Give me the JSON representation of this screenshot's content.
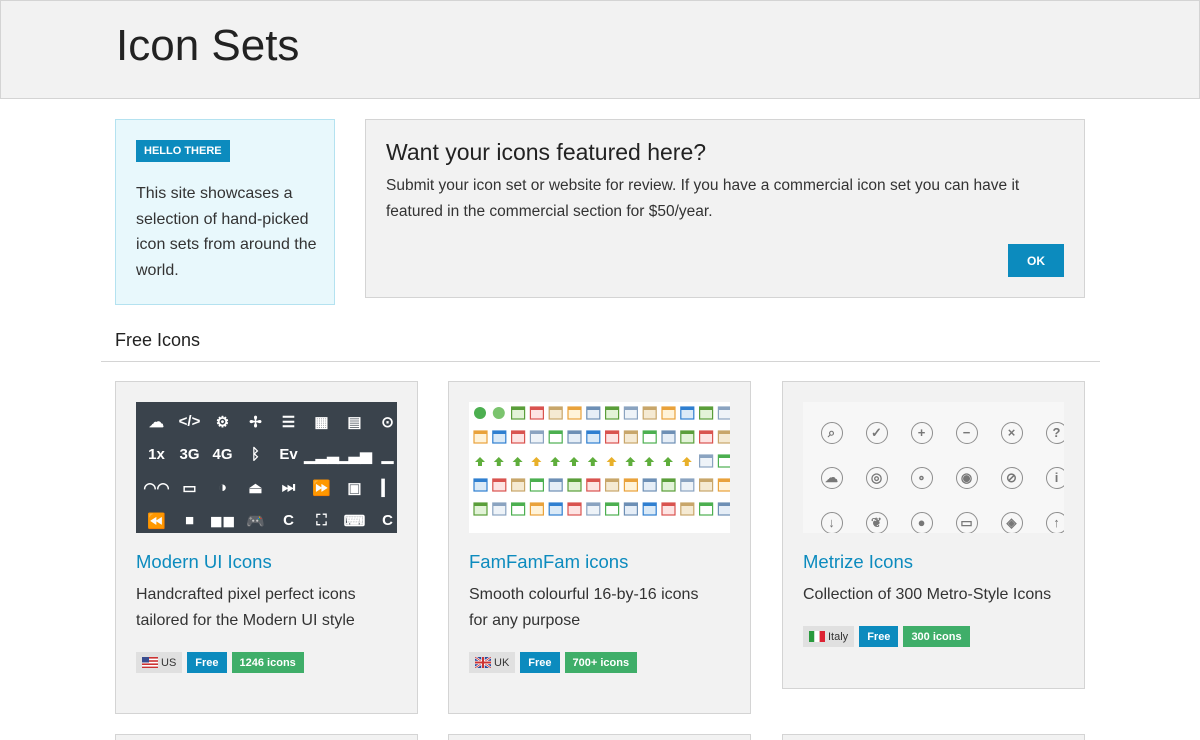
{
  "header": {
    "title": "Icon Sets"
  },
  "hello": {
    "badge": "HELLO THERE",
    "text": "This site showcases a selection of hand-picked icon sets from around the world."
  },
  "feature": {
    "title": "Want your icons featured here?",
    "text": "Submit your icon set or website for review. If you have a commercial icon set you can have it featured in the commercial section for $50/year.",
    "ok_label": "OK"
  },
  "section": {
    "title": "Free Icons"
  },
  "cards": [
    {
      "title": "Modern UI Icons",
      "description": "Handcrafted pixel perfect icons tailored for the Modern UI style",
      "country": "US",
      "license": "Free",
      "count": "1246 icons",
      "thumb_glyphs": [
        "☁",
        "</>",
        "⚙",
        "✢",
        "☰",
        "▦",
        "▤",
        "⊙",
        "1x",
        "3G",
        "4G",
        "ᛒ",
        "Ev",
        "▁▂▃",
        "▁▃▅",
        "▁",
        "◠◠",
        "▭",
        "◑",
        "⏏",
        "⏭",
        "⏩",
        "▣",
        "▎",
        "⏪",
        "■",
        "◼◼",
        "🎮",
        "C",
        "⛶",
        "⌨",
        "C"
      ]
    },
    {
      "title": "FamFamFam icons",
      "description": "Smooth colourful 16-by-16 icons for any purpose",
      "country": "UK",
      "license": "Free",
      "count": "700+ icons"
    },
    {
      "title": "Metrize Icons",
      "description": "Collection of 300 Metro-Style Icons",
      "country": "Italy",
      "license": "Free",
      "count": "300 icons",
      "thumb_glyphs": [
        "⌕",
        "✓",
        "+",
        "−",
        "×",
        "?",
        "☁",
        "◎",
        "∘",
        "◉",
        "⊘",
        "i",
        "↓",
        "❦",
        "●",
        "▭",
        "◈",
        "↑"
      ]
    }
  ],
  "colors": {
    "accent": "#0c8bbe",
    "count_badge": "#3fae69",
    "panel": "#f2f2f2",
    "hello_bg": "#e8f8fc"
  }
}
